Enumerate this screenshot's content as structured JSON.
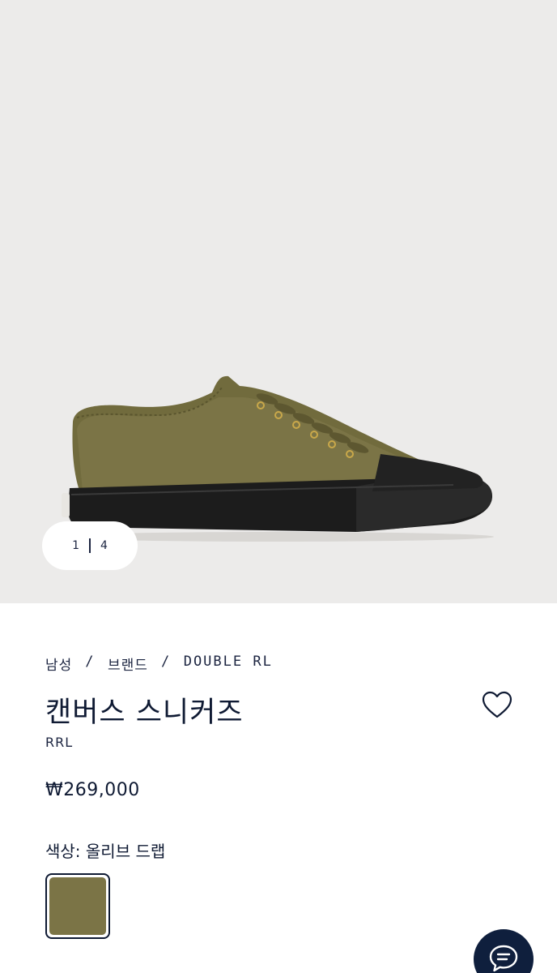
{
  "gallery": {
    "current": "1",
    "total": "4",
    "background": "#ecebea"
  },
  "breadcrumb": {
    "items": [
      "남성",
      "브랜드",
      "DOUBLE RL"
    ],
    "separator": "/"
  },
  "product": {
    "title": "캔버스 스니커즈",
    "brand": "RRL",
    "price": "₩269,000",
    "color_label": "색상: 올리브 드랩"
  },
  "swatches": [
    {
      "name": "올리브 드랩",
      "hex": "#7b7446",
      "selected": true
    }
  ],
  "icons": {
    "wishlist": "heart-icon",
    "chat": "chat-bubble-icon"
  },
  "colors": {
    "navy": "#0f1f3d",
    "olive": "#7b7446",
    "sole": "#1c1c1c"
  }
}
